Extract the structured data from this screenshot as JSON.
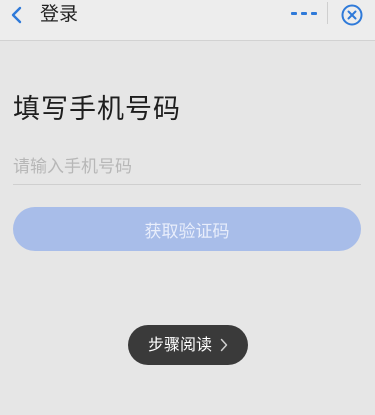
{
  "header": {
    "back_icon": "chevron-left-icon",
    "title": "登录",
    "more_icon": "more-dots-icon",
    "close_icon": "close-circle-icon"
  },
  "main": {
    "title": "填写手机号码",
    "phone_input": {
      "placeholder": "请输入手机号码",
      "value": ""
    },
    "get_code_button": {
      "label": "获取验证码",
      "state": "disabled"
    }
  },
  "floating": {
    "step_read_label": "步骤阅读",
    "icon": "chevron-right-icon"
  },
  "colors": {
    "accent": "#2f7ad9",
    "button_disabled": "#a8bde9",
    "background": "#e6e6e6",
    "pill": "#3a3a3a"
  }
}
